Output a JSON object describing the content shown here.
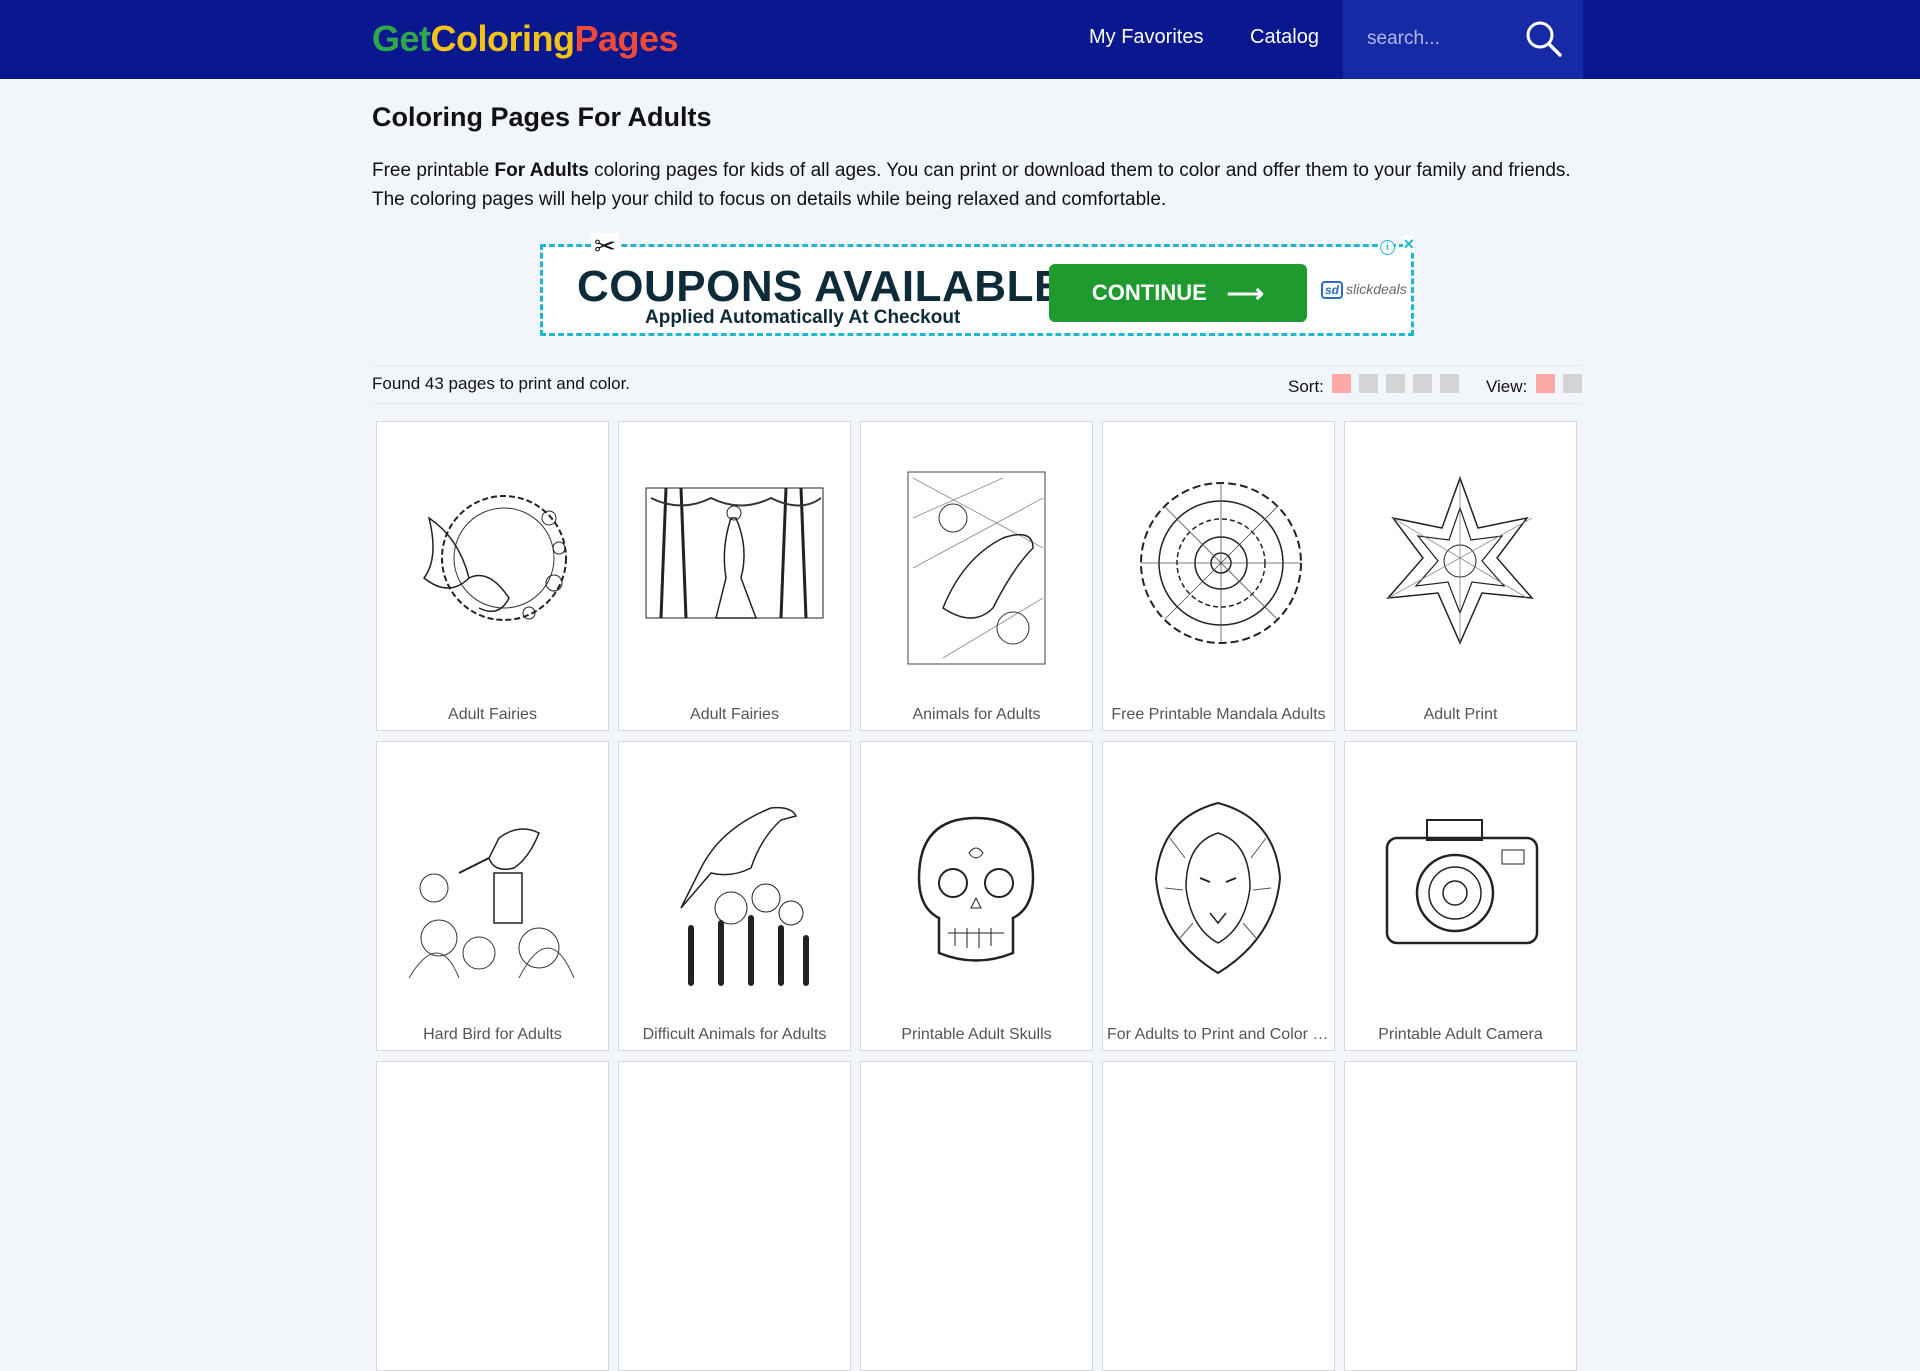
{
  "header": {
    "logo": {
      "part1": "Get",
      "part2": "Coloring",
      "part3": "Pages"
    },
    "nav": [
      {
        "label": "My Favorites"
      },
      {
        "label": "Catalog"
      }
    ],
    "search": {
      "placeholder": "search..."
    }
  },
  "page": {
    "title": "Coloring Pages For Adults",
    "desc_before": "Free printable ",
    "desc_bold": "For Adults",
    "desc_after": " coloring pages for kids of all ages. You can print or download them to color and offer them to your family and friends. The coloring pages will help your child to focus on details while being relaxed and comfortable."
  },
  "ad": {
    "headline": "COUPONS AVAILABLE",
    "sub": "Applied Automatically At Checkout",
    "button": "CONTINUE",
    "brand_mark": "sd",
    "brand": "slickdeals"
  },
  "results": {
    "found": "Found 43 pages to print and color.",
    "sort_label": "Sort:",
    "view_label": "View:"
  },
  "cards": [
    {
      "caption": "Adult Fairies",
      "icon": "fairy-coloring-image"
    },
    {
      "caption": "Adult Fairies",
      "icon": "fairy-forest-coloring-image"
    },
    {
      "caption": "Animals for Adults",
      "icon": "bird-pattern-coloring-image"
    },
    {
      "caption": "Free Printable Mandala Adults",
      "icon": "mandala-coloring-image"
    },
    {
      "caption": "Adult Print",
      "icon": "star-mandala-coloring-image"
    },
    {
      "caption": "Hard Bird for Adults",
      "icon": "bird-flowers-coloring-image"
    },
    {
      "caption": "Difficult Animals for Adults",
      "icon": "bird-cactus-coloring-image"
    },
    {
      "caption": "Printable Adult Skulls",
      "icon": "sugar-skull-coloring-image"
    },
    {
      "caption": "For Adults to Print and Color Lion",
      "icon": "lion-coloring-image"
    },
    {
      "caption": "Printable Adult Camera",
      "icon": "camera-coloring-image"
    }
  ],
  "colors": {
    "nav_bg": "#0a1890",
    "sort_active": "#ffa8a8",
    "sort_inactive": "#d4d4d4",
    "ad_button": "#1e9a2e",
    "ad_border": "#1fb8d2"
  }
}
